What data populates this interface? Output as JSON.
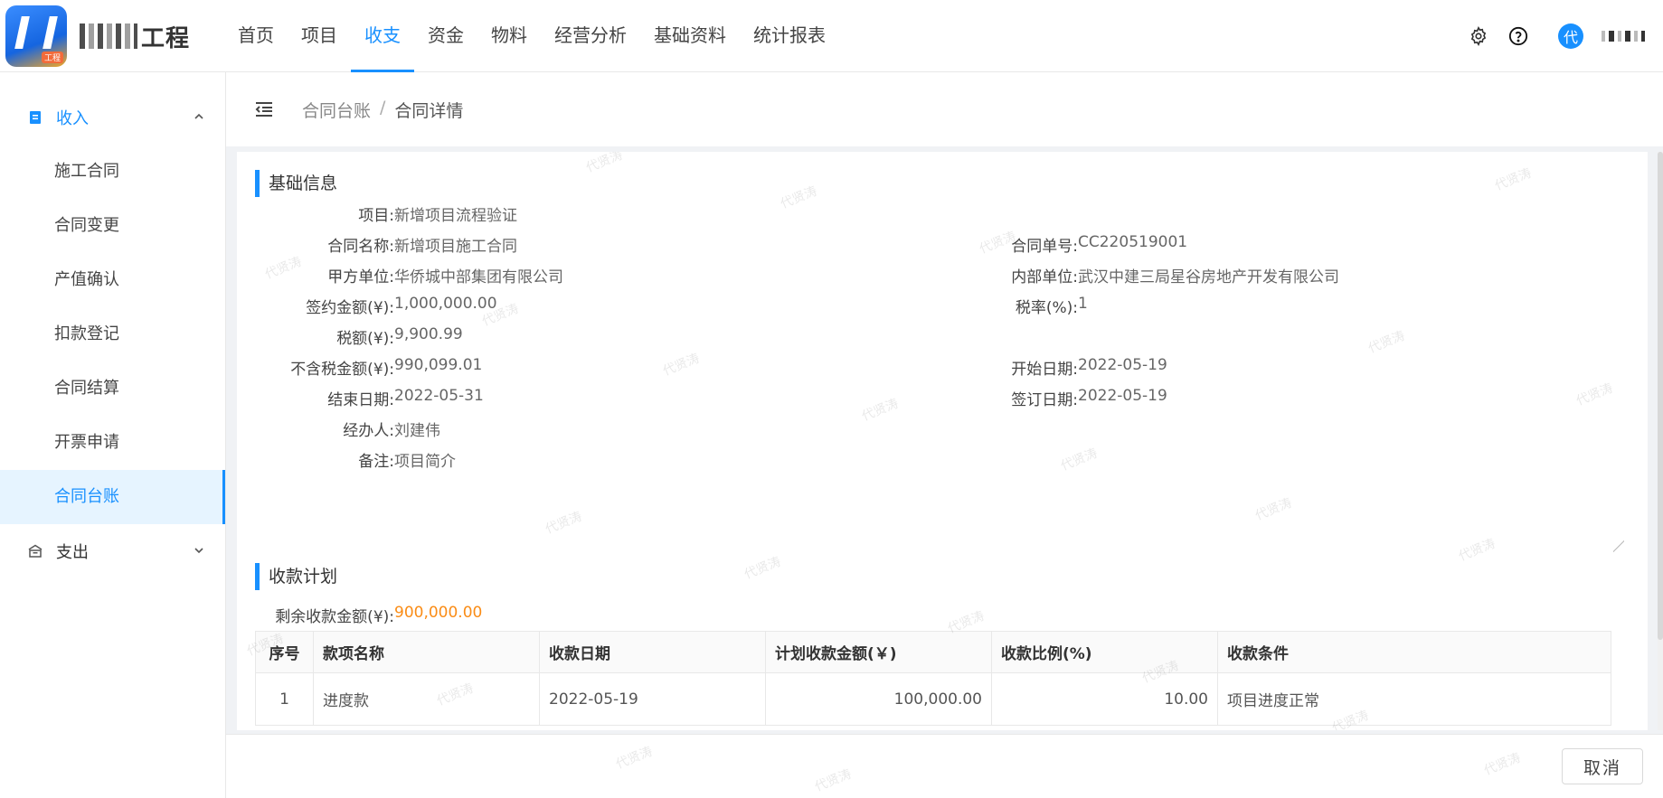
{
  "brand": {
    "logo_sub": "工程",
    "name_suffix": "工程"
  },
  "nav": {
    "items": [
      "首页",
      "项目",
      "收支",
      "资金",
      "物料",
      "经营分析",
      "基础资料",
      "统计报表"
    ],
    "active_index": 2
  },
  "user": {
    "avatar_text": "代"
  },
  "sidebar": {
    "income_group": "收入",
    "income_items": [
      "施工合同",
      "合同变更",
      "产值确认",
      "扣款登记",
      "合同结算",
      "开票申请",
      "合同台账"
    ],
    "active_item": "合同台账",
    "expense_group": "支出"
  },
  "breadcrumb": {
    "parent": "合同台账",
    "separator": "/",
    "current": "合同详情"
  },
  "basic_info": {
    "title": "基础信息",
    "project_label": "项目:",
    "project": "新增项目流程验证",
    "contract_name_label": "合同名称:",
    "contract_name": "新增项目施工合同",
    "contract_no_label": "合同单号:",
    "contract_no": "CC220519001",
    "party_a_label": "甲方单位:",
    "party_a": "华侨城中部集团有限公司",
    "internal_unit_label": "内部单位:",
    "internal_unit": "武汉中建三局星谷房地产开发有限公司",
    "signed_amount_label": "签约金额(¥):",
    "signed_amount": "1,000,000.00",
    "tax_rate_label": "税率(%):",
    "tax_rate": "1",
    "tax_amount_label": "税额(¥):",
    "tax_amount": "9,900.99",
    "ex_tax_label": "不含税金额(¥):",
    "ex_tax": "990,099.01",
    "start_date_label": "开始日期:",
    "start_date": "2022-05-19",
    "end_date_label": "结束日期:",
    "end_date": "2022-05-31",
    "sign_date_label": "签订日期:",
    "sign_date": "2022-05-19",
    "handler_label": "经办人:",
    "handler": "刘建伟",
    "remark_label": "备注:",
    "remark": "项目简介"
  },
  "collection_plan": {
    "title": "收款计划",
    "remaining_label": "剩余收款金额(¥):",
    "remaining": "900,000.00",
    "columns": [
      "序号",
      "款项名称",
      "收款日期",
      "计划收款金额(￥)",
      "收款比例(%)",
      "收款条件"
    ],
    "rows": [
      {
        "no": "1",
        "name": "进度款",
        "date": "2022-05-19",
        "amount": "100,000.00",
        "ratio": "10.00",
        "condition": "项目进度正常"
      }
    ]
  },
  "footer": {
    "cancel_label": "取消"
  },
  "watermark": "代贤涛",
  "colors": {
    "primary": "#1890ff",
    "highlight": "#fa8c16"
  }
}
